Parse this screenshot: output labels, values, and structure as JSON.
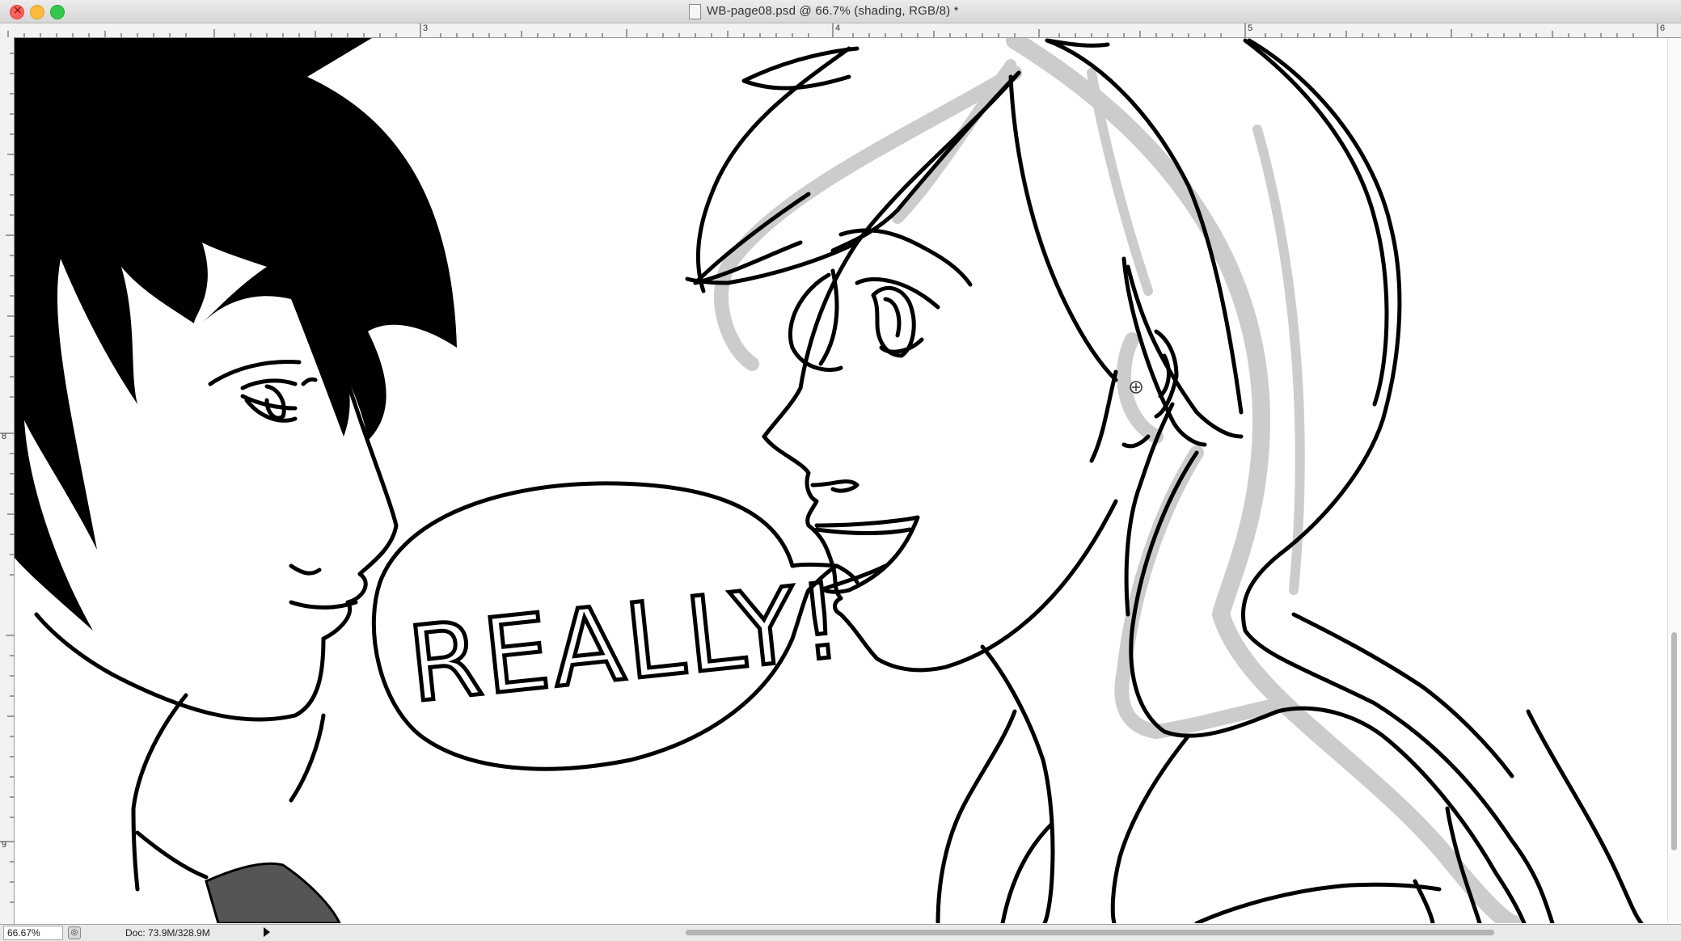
{
  "window": {
    "title": "WB-page08.psd @ 66.7% (shading, RGB/8) *"
  },
  "rulers": {
    "top_labels": [
      "3",
      "4",
      "5",
      "6"
    ],
    "left_labels": [
      "8",
      "9"
    ]
  },
  "artwork": {
    "speech_bubble_text": "REALLY!"
  },
  "status_bar": {
    "zoom": "66.67%",
    "doc_info": "Doc: 73.9M/328.9M"
  },
  "colors": {
    "ink": "#000000",
    "shading": "#cccccc",
    "paper": "#ffffff",
    "shirt": "#555555"
  }
}
